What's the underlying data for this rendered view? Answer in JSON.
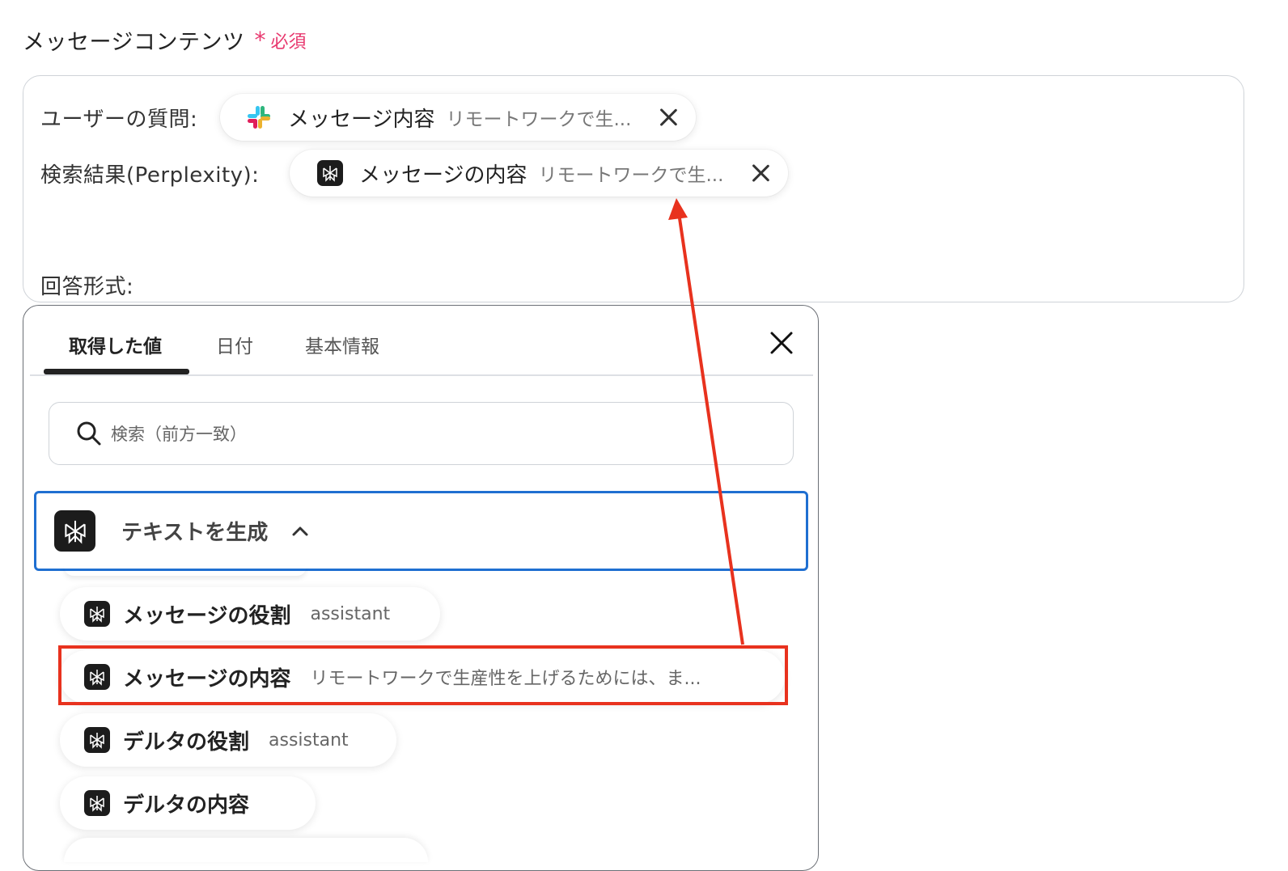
{
  "field": {
    "label": "メッセージコンテンツ",
    "required_star": "*",
    "required_text": "必須"
  },
  "editor": {
    "line1_label": "ユーザーの質問:",
    "line2_label": "検索結果(Perplexity):",
    "line3_label": "回答形式:",
    "pill1": {
      "icon": "slack-icon",
      "label": "メッセージ内容",
      "value": "リモートワークで生..."
    },
    "pill2": {
      "icon": "perplexity-icon",
      "label": "メッセージの内容",
      "value": "リモートワークで生..."
    }
  },
  "panel": {
    "tabs": [
      "取得した値",
      "日付",
      "基本情報"
    ],
    "active_tab": 0,
    "search_placeholder": "検索（前方一致）",
    "group_label": "テキストを生成",
    "items": [
      {
        "label": "メッセージの役割",
        "value": "assistant"
      },
      {
        "label": "メッセージの内容",
        "value": "リモートワークで生産性を上げるためには、ま..."
      },
      {
        "label": "デルタの役割",
        "value": "assistant"
      },
      {
        "label": "デルタの内容",
        "value": ""
      }
    ]
  },
  "colors": {
    "required": "#e8396f",
    "group_border": "#1f6fd1",
    "highlight": "#e8321e",
    "arrow": "#e8321e"
  }
}
